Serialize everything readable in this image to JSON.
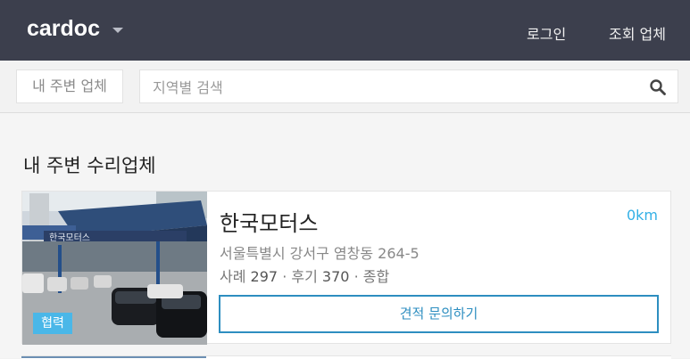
{
  "header": {
    "logo": "cardoc",
    "login": "로그인",
    "inquiry_shops": "조회 업체"
  },
  "search": {
    "nearby_tab": "내 주변 업체",
    "placeholder": "지역별 검색",
    "value": ""
  },
  "section": {
    "title": "내 주변 수리업체"
  },
  "shops": [
    {
      "name": "한국모터스",
      "distance": "0km",
      "address": "서울특별시 강서구 염창동 264-5",
      "cases_label": "사례",
      "cases": "297",
      "reviews_label": "후기",
      "reviews": "370",
      "category": "종합",
      "badge": "협력",
      "button": "견적 문의하기",
      "photo_sign": "한국모터스"
    }
  ],
  "colors": {
    "header_bg": "#3c3f4d",
    "accent": "#33b0e6",
    "button_border": "#2d8ec0",
    "badge_bg": "#4ab7e8"
  },
  "icons": {
    "search": "search-icon",
    "dropdown": "caret-down-icon"
  }
}
